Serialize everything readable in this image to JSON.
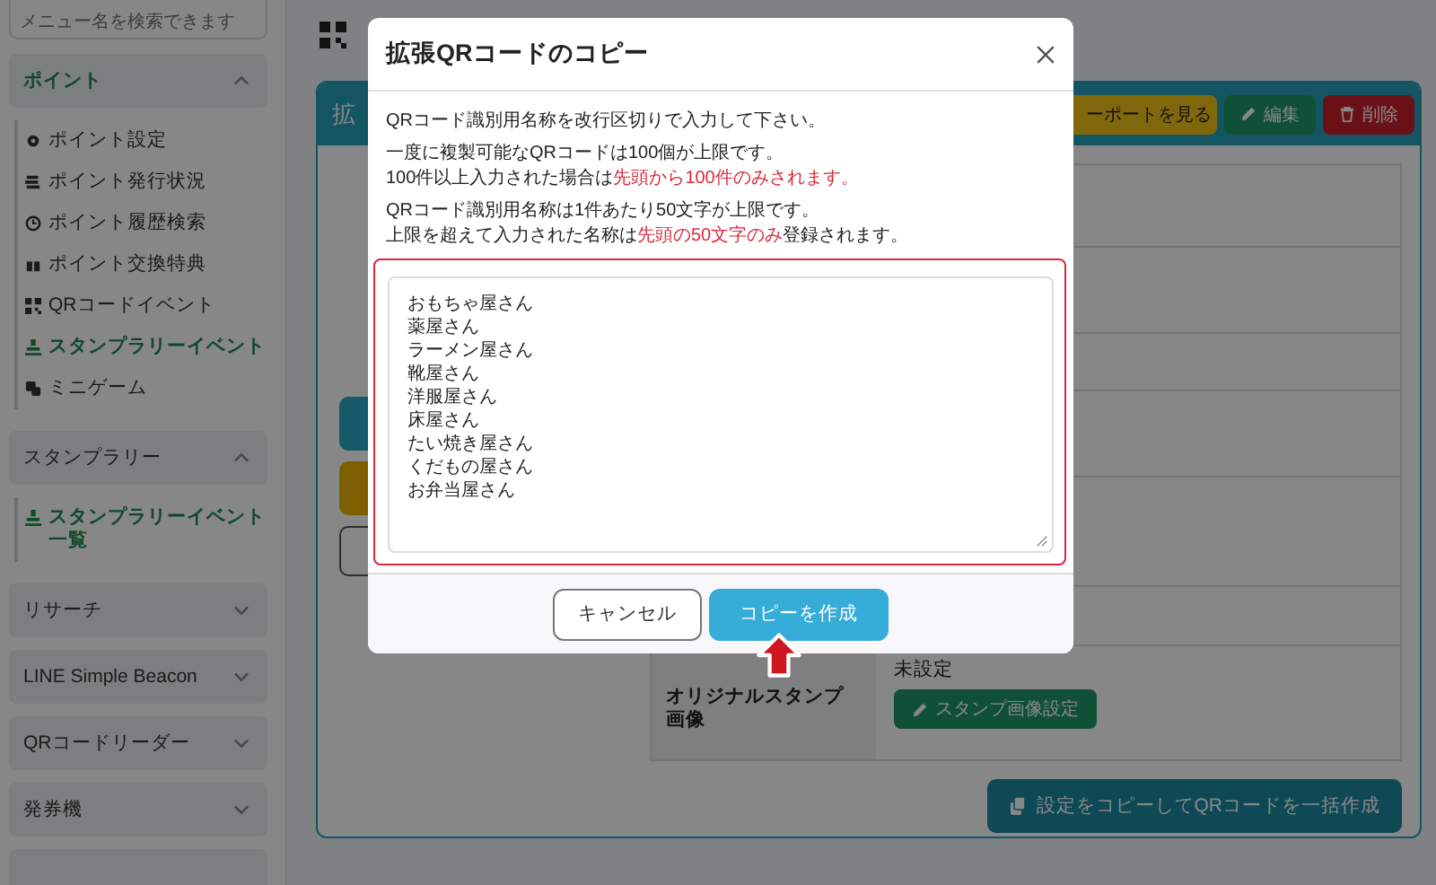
{
  "sidebar": {
    "search": {
      "placeholder": "メニュー名を検索できます"
    },
    "groups": [
      {
        "label": "ポイント",
        "expanded": true,
        "selected": true,
        "items": [
          {
            "label": "ポイント設定",
            "selected": false
          },
          {
            "label": "ポイント発行状況",
            "selected": false
          },
          {
            "label": "ポイント履歴検索",
            "selected": false
          },
          {
            "label": "ポイント交換特典",
            "selected": false
          },
          {
            "label": "QRコードイベント",
            "selected": false
          },
          {
            "label": "スタンプラリーイベント",
            "selected": true
          },
          {
            "label": "ミニゲーム",
            "selected": false
          }
        ]
      },
      {
        "label": "スタンプラリー",
        "expanded": true,
        "selected": false,
        "items": [
          {
            "label": "スタンプラリーイベント一覧",
            "selected": true
          }
        ]
      },
      {
        "label": "リサーチ",
        "expanded": false,
        "selected": false
      },
      {
        "label": "LINE Simple Beacon",
        "expanded": false,
        "selected": false
      },
      {
        "label": "QRコードリーダー",
        "expanded": false,
        "selected": false
      },
      {
        "label": "発券機",
        "expanded": false,
        "selected": false
      }
    ]
  },
  "card": {
    "title": "拡",
    "header_buttons": [
      {
        "label": "ーポートを見る",
        "kind": "warning"
      },
      {
        "label": "編集",
        "kind": "success"
      },
      {
        "label": "削除",
        "kind": "danger"
      }
    ],
    "rows": [
      {
        "label": "オリジナルスタンプ画像",
        "value": "未設定",
        "button": "スタンプ画像設定"
      }
    ],
    "bulk_button": "設定をコピーしてQRコードを一括作成"
  },
  "modal": {
    "title": "拡張QRコードのコピー",
    "paragraphs": [
      {
        "lines": [
          {
            "parts": [
              {
                "text": "QRコード識別用名称を改行区切りで入力して下さい。",
                "emphasis": false
              }
            ]
          }
        ]
      },
      {
        "lines": [
          {
            "parts": [
              {
                "text": "一度に複製可能なQRコードは100個が上限です。",
                "emphasis": false
              }
            ]
          },
          {
            "parts": [
              {
                "text": "100件以上入力された場合は",
                "emphasis": false
              },
              {
                "text": "先頭から100件のみされます。",
                "emphasis": true
              }
            ]
          }
        ]
      },
      {
        "lines": [
          {
            "parts": [
              {
                "text": "QRコード識別用名称は1件あたり50文字が上限です。",
                "emphasis": false
              }
            ]
          },
          {
            "parts": [
              {
                "text": "上限を超えて入力された名称は",
                "emphasis": false
              },
              {
                "text": "先頭の50文字のみ",
                "emphasis": true
              },
              {
                "text": "登録されます。",
                "emphasis": false
              }
            ]
          }
        ]
      }
    ],
    "textarea": {
      "lines": [
        "おもちゃ屋さん",
        "薬屋さん",
        "ラーメン屋さん",
        "靴屋さん",
        "洋服屋さん",
        "床屋さん",
        "たい焼き屋さん",
        "くだもの屋さん",
        "お弁当屋さん"
      ]
    },
    "buttons": [
      {
        "label": "キャンセル",
        "kind": "secondary"
      },
      {
        "label": "コピーを作成",
        "kind": "primary"
      }
    ]
  }
}
